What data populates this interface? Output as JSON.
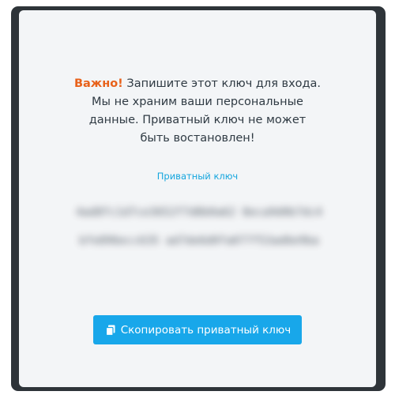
{
  "warning": {
    "important": "Важно!",
    "line1_rest": " Запишите этот ключ для входа.",
    "line2": "Мы не храним ваши персональные",
    "line3": "данные. Приватный ключ не может",
    "line4": "быть востановлен!"
  },
  "key": {
    "label": "Приватный ключ",
    "value": "4ad8fc1d7ce3652f7d8b0a62 8eca9d0b7dc4bfe896ecc635 ad7de6d0fa077f53ad6e9ba"
  },
  "copy_button": {
    "label": "Скопировать приватный ключ",
    "icon": "copy-icon"
  },
  "colors": {
    "accent": "#18a7ea",
    "important": "#e8611a",
    "label": "#13a5de",
    "frame": "#2e3439"
  }
}
